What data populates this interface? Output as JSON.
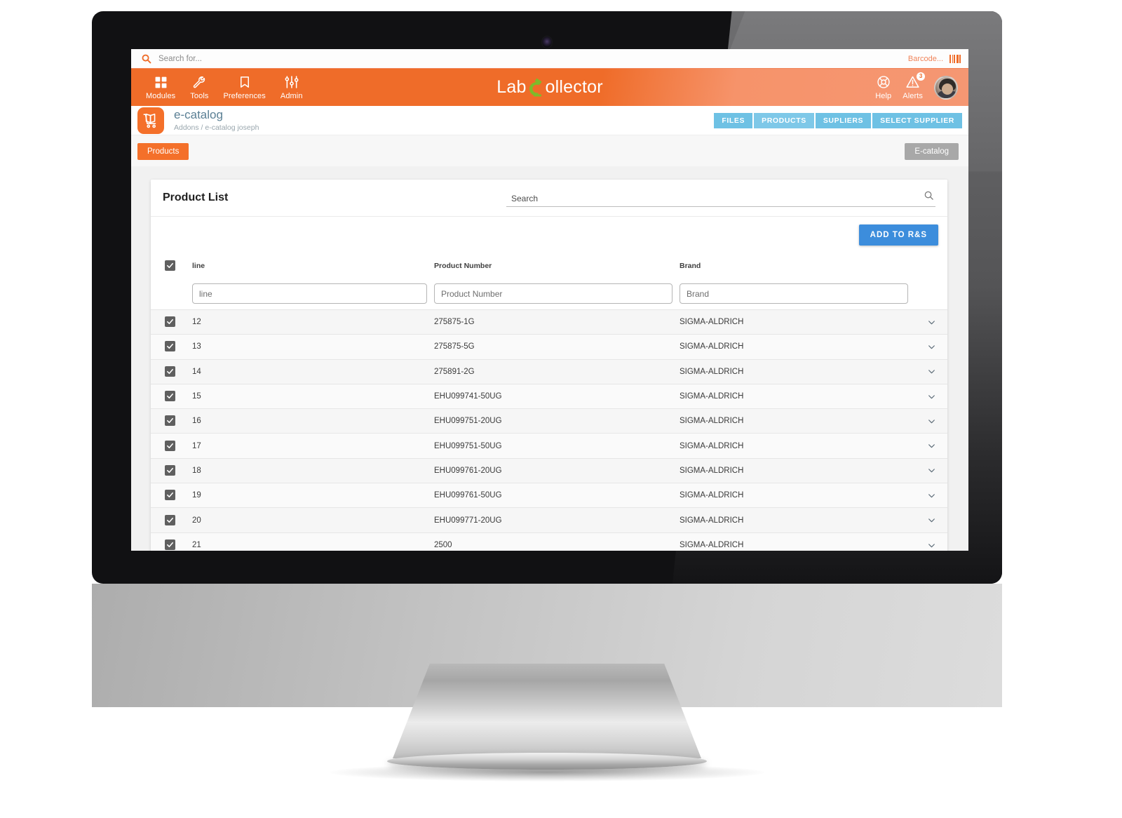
{
  "topbar": {
    "search_placeholder": "Search for...",
    "barcode_label": "Barcode...",
    "search_icon": "search-icon",
    "barcode_icon": "barcode-icon"
  },
  "mainnav": {
    "items": [
      {
        "label": "Modules",
        "icon": "grid-icon"
      },
      {
        "label": "Tools",
        "icon": "wrench-icon"
      },
      {
        "label": "Preferences",
        "icon": "bookmark-icon"
      },
      {
        "label": "Admin",
        "icon": "sliders-icon"
      }
    ],
    "logo": {
      "part1": "Lab",
      "part2": "C",
      "part3": "ollector"
    },
    "right": [
      {
        "label": "Help",
        "icon": "lifebuoy-icon"
      },
      {
        "label": "Alerts",
        "icon": "warning-triangle-icon",
        "badge": "3"
      }
    ],
    "avatar_name": "user-avatar"
  },
  "module": {
    "icon": "book-cart-icon",
    "title": "e-catalog",
    "breadcrumb": "Addons / e-catalog joseph",
    "tabs": [
      {
        "label": "FILES"
      },
      {
        "label": "PRODUCTS"
      },
      {
        "label": "SUPLIERS"
      },
      {
        "label": "SELECT SUPPLIER"
      }
    ]
  },
  "subbar": {
    "left_button": "Products",
    "right_button": "E-catalog"
  },
  "card": {
    "title": "Product List",
    "search_placeholder": "Search",
    "search_value": "",
    "search_icon": "magnifier-icon",
    "add_button": "ADD TO R&S"
  },
  "table": {
    "headers": [
      "line",
      "Product Number",
      "Brand"
    ],
    "filters": [
      {
        "placeholder": "line",
        "value": ""
      },
      {
        "placeholder": "Product Number",
        "value": ""
      },
      {
        "placeholder": "Brand",
        "value": ""
      }
    ],
    "select_all_checked": true,
    "rows": [
      {
        "line": "12",
        "product_number": "275875-1G",
        "brand": "SIGMA-ALDRICH",
        "checked": true
      },
      {
        "line": "13",
        "product_number": "275875-5G",
        "brand": "SIGMA-ALDRICH",
        "checked": true
      },
      {
        "line": "14",
        "product_number": "275891-2G",
        "brand": "SIGMA-ALDRICH",
        "checked": true
      },
      {
        "line": "15",
        "product_number": "EHU099741-50UG",
        "brand": "SIGMA-ALDRICH",
        "checked": true
      },
      {
        "line": "16",
        "product_number": "EHU099751-20UG",
        "brand": "SIGMA-ALDRICH",
        "checked": true
      },
      {
        "line": "17",
        "product_number": "EHU099751-50UG",
        "brand": "SIGMA-ALDRICH",
        "checked": true
      },
      {
        "line": "18",
        "product_number": "EHU099761-20UG",
        "brand": "SIGMA-ALDRICH",
        "checked": true
      },
      {
        "line": "19",
        "product_number": "EHU099761-50UG",
        "brand": "SIGMA-ALDRICH",
        "checked": true
      },
      {
        "line": "20",
        "product_number": "EHU099771-20UG",
        "brand": "SIGMA-ALDRICH",
        "checked": true
      },
      {
        "line": "21",
        "product_number": "2500",
        "brand": "SIGMA-ALDRICH",
        "checked": true
      }
    ],
    "expand_icon": "chevron-down-icon"
  },
  "colors": {
    "brand_orange": "#ef6c29",
    "nav_blue": "#6ec1e4",
    "button_blue": "#3c8ddc",
    "module_title": "#5a7f94",
    "row_bg": "#f6f6f6"
  }
}
